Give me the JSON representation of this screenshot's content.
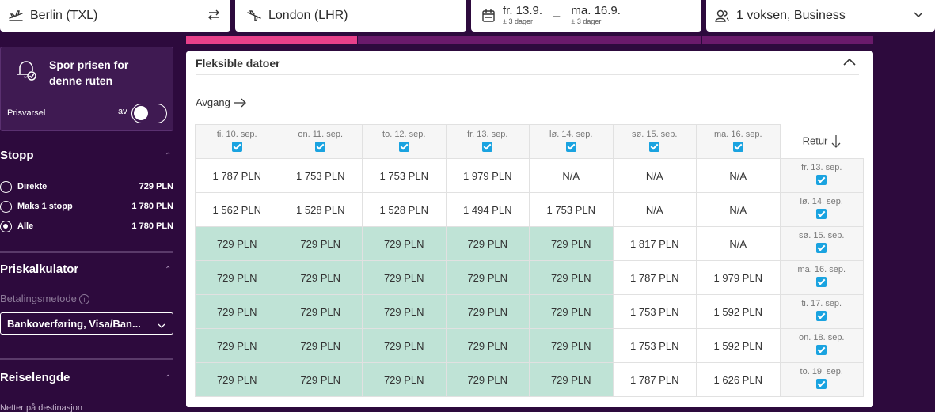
{
  "search": {
    "from": "Berlin (TXL)",
    "to": "London (LHR)",
    "depart_date": "fr. 13.9.",
    "depart_flex": "± 3 dager",
    "date_separator": "–",
    "return_date": "ma. 16.9.",
    "return_flex": "± 3 dager",
    "passengers": "1 voksen, Business"
  },
  "sidebar": {
    "alert_title": "Spor prisen for denne ruten",
    "alert_label": "Prisvarsel",
    "toggle_state": "av",
    "stops_heading": "Stopp",
    "stops": [
      {
        "label": "Direkte",
        "price": "729 PLN",
        "selected": false
      },
      {
        "label": "Maks 1 stopp",
        "price": "1 780 PLN",
        "selected": false
      },
      {
        "label": "Alle",
        "price": "1 780 PLN",
        "selected": true
      }
    ],
    "calc_heading": "Priskalkulator",
    "payment_label": "Betalingsmetode",
    "payment_value": "Bankoverføring, Visa/Ban...",
    "duration_heading": "Reiselengde",
    "duration_sub": "Netter på destinasjon"
  },
  "flex": {
    "title": "Fleksible datoer",
    "departure_label": "Avgang",
    "return_label": "Retur",
    "departure_dates": [
      "ti. 10. sep.",
      "on. 11. sep.",
      "to. 12. sep.",
      "fr. 13. sep.",
      "lø. 14. sep.",
      "sø. 15. sep.",
      "ma. 16. sep."
    ],
    "return_dates": [
      "fr. 13. sep.",
      "lø. 14. sep.",
      "sø. 15. sep.",
      "ma. 16. sep.",
      "ti. 17. sep.",
      "on. 18. sep.",
      "to. 19. sep."
    ],
    "prices": [
      [
        "1 787 PLN",
        "1 753 PLN",
        "1 753 PLN",
        "1 979 PLN",
        "N/A",
        "N/A",
        "N/A"
      ],
      [
        "1 562 PLN",
        "1 528 PLN",
        "1 528 PLN",
        "1 494 PLN",
        "1 753 PLN",
        "N/A",
        "N/A"
      ],
      [
        "729 PLN",
        "729 PLN",
        "729 PLN",
        "729 PLN",
        "729 PLN",
        "1 817 PLN",
        "N/A"
      ],
      [
        "729 PLN",
        "729 PLN",
        "729 PLN",
        "729 PLN",
        "729 PLN",
        "1 787 PLN",
        "1 979 PLN"
      ],
      [
        "729 PLN",
        "729 PLN",
        "729 PLN",
        "729 PLN",
        "729 PLN",
        "1 753 PLN",
        "1 592 PLN"
      ],
      [
        "729 PLN",
        "729 PLN",
        "729 PLN",
        "729 PLN",
        "729 PLN",
        "1 753 PLN",
        "1 592 PLN"
      ],
      [
        "729 PLN",
        "729 PLN",
        "729 PLN",
        "729 PLN",
        "729 PLN",
        "1 787 PLN",
        "1 626 PLN"
      ]
    ],
    "highlight_color": "#bfe3d6",
    "high_price_color": "#d9392e"
  },
  "colors": {
    "background": "#2d0a3d",
    "accent": "#e8408a",
    "checkbox": "#1aa3e0"
  }
}
